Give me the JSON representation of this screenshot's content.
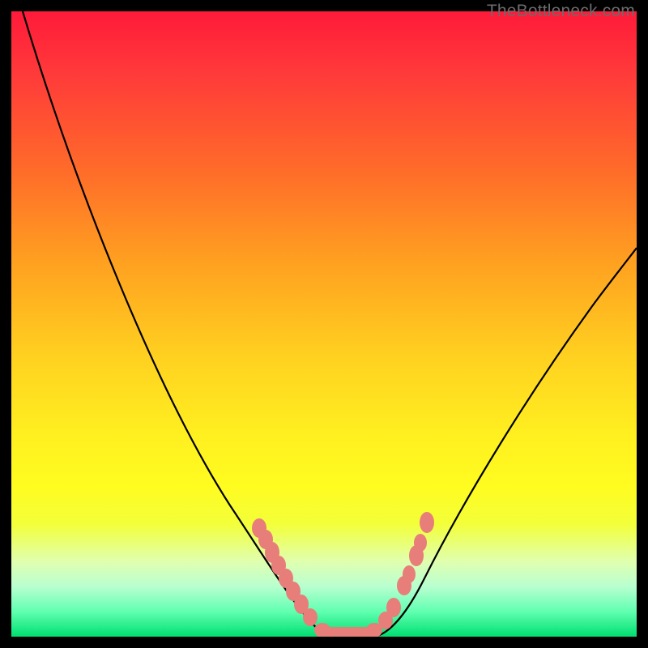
{
  "watermark": "TheBottleneck.com",
  "colors": {
    "curve": "#000000",
    "blotch": "#e77e7a",
    "frame": "#000000"
  },
  "chart_data": {
    "type": "line",
    "title": "",
    "xlabel": "",
    "ylabel": "",
    "xlim": [
      0,
      100
    ],
    "ylim": [
      0,
      100
    ],
    "series": [
      {
        "name": "left-curve",
        "x": [
          2,
          10,
          20,
          30,
          38,
          43,
          47,
          50
        ],
        "y": [
          100,
          74,
          48,
          28,
          14,
          7,
          2,
          0
        ]
      },
      {
        "name": "right-curve",
        "x": [
          58,
          62,
          65,
          70,
          78,
          88,
          98
        ],
        "y": [
          0,
          4,
          9,
          18,
          33,
          50,
          65
        ]
      }
    ],
    "annotations": {
      "flat_bottom_band": {
        "x_range": [
          49,
          59
        ],
        "y": 0
      },
      "blotches_left": [
        {
          "x": 40,
          "y": 18
        },
        {
          "x": 41,
          "y": 16
        },
        {
          "x": 42,
          "y": 13
        },
        {
          "x": 43,
          "y": 11
        },
        {
          "x": 44,
          "y": 9
        },
        {
          "x": 45,
          "y": 7
        },
        {
          "x": 46,
          "y": 5
        }
      ],
      "blotches_right": [
        {
          "x": 62,
          "y": 8
        },
        {
          "x": 63,
          "y": 11
        },
        {
          "x": 64,
          "y": 13
        },
        {
          "x": 64,
          "y": 14
        },
        {
          "x": 65,
          "y": 17
        },
        {
          "x": 66,
          "y": 20
        }
      ]
    }
  }
}
